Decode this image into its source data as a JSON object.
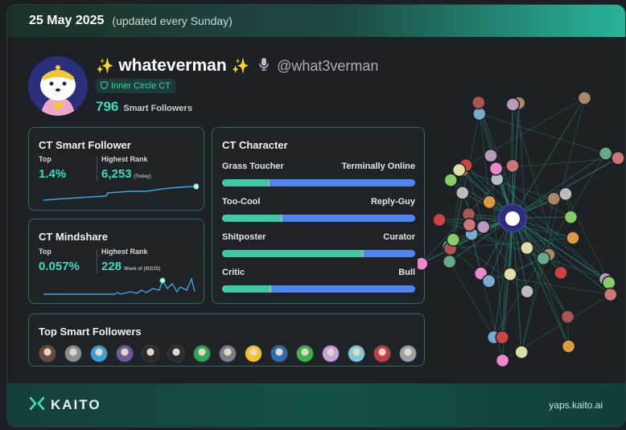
{
  "header": {
    "date": "25 May 2025",
    "update_note": "(updated every Sunday)"
  },
  "profile": {
    "name": "whateverman",
    "sparkle_glyph": "✨",
    "handle": "@what3verman",
    "badge": "Inner Circle CT",
    "smart_followers_count": "796",
    "smart_followers_label": "Smart Followers"
  },
  "smart_follower": {
    "title": "CT Smart Follower",
    "top_label": "Top",
    "top_value": "1.4%",
    "rank_label": "Highest Rank",
    "rank_value": "6,253",
    "rank_note": "(Today)"
  },
  "mindshare": {
    "title": "CT Mindshare",
    "top_label": "Top",
    "top_value": "0.057%",
    "rank_label": "Highest Rank",
    "rank_value": "228",
    "rank_note": "Week of (9/2/25)"
  },
  "character": {
    "title": "CT Character",
    "rows": [
      {
        "left": "Grass Toucher",
        "right": "Terminally Online",
        "value": 0.24
      },
      {
        "left": "Too-Cool",
        "right": "Reply-Guy",
        "value": 0.31
      },
      {
        "left": "Shitposter",
        "right": "Curator",
        "value": 0.73
      },
      {
        "left": "Critic",
        "right": "Bull",
        "value": 0.25
      }
    ]
  },
  "top_followers": {
    "title": "Top Smart Followers",
    "avatar_colors": [
      "#6b4a3a",
      "#8a8f94",
      "#3aa0d8",
      "#6b5aa0",
      "#2a2a2a",
      "#2a2d30",
      "#2fa55a",
      "#7a7f88",
      "#f2c230",
      "#2b6fb0",
      "#39b54a",
      "#c7a0e0",
      "#7fc8d8",
      "#c04040",
      "#9aa0a8"
    ]
  },
  "footer": {
    "brand": "KAITO",
    "site": "yaps.kaito.ai"
  },
  "colors": {
    "accent": "#35e0bd",
    "bar_blue": "#5086f2",
    "bar_green": "#3cc9a3"
  }
}
